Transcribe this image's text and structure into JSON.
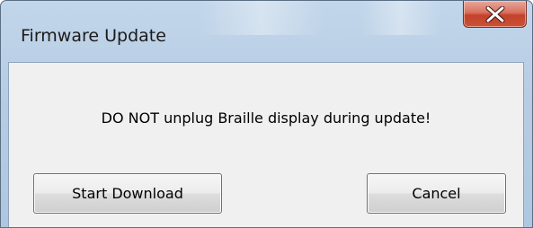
{
  "window": {
    "title": "Firmware Update",
    "close_icon": "close-x-icon"
  },
  "dialog": {
    "message": "DO NOT unplug Braille display during update!"
  },
  "buttons": {
    "start_download_label": "Start Download",
    "cancel_label": "Cancel"
  },
  "colors": {
    "titlebar": "#b7cde4",
    "client_bg": "#f0f0f0",
    "close_button": "#c4412a"
  }
}
